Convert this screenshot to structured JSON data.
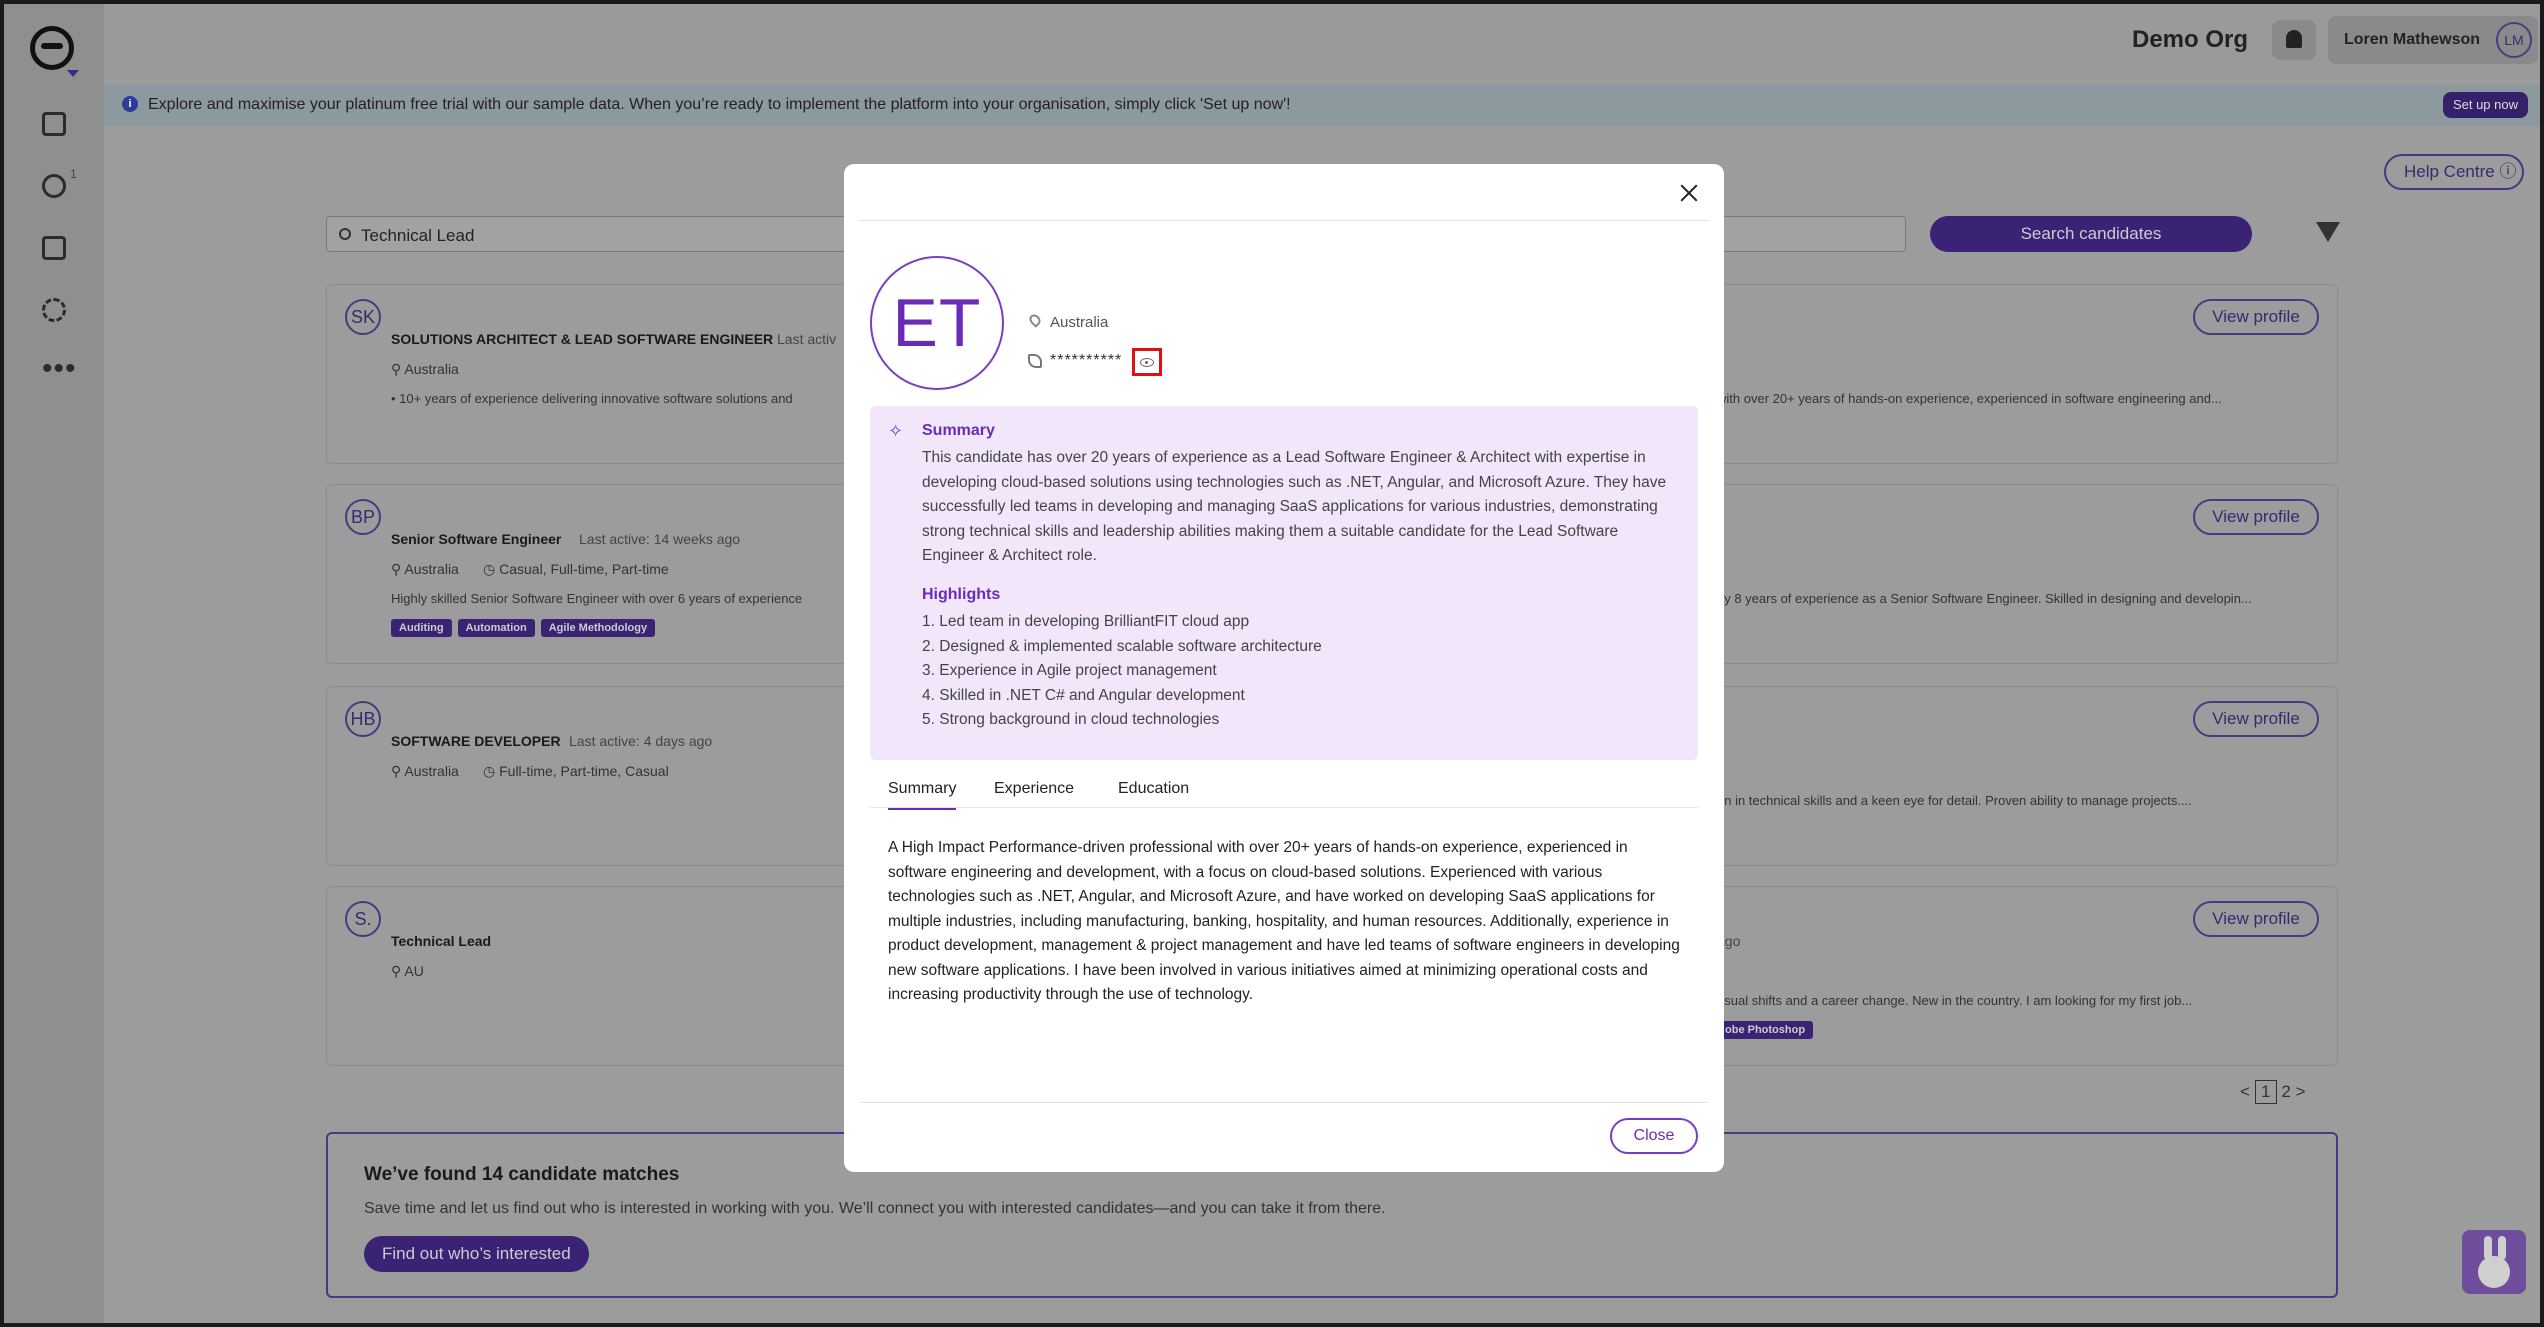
{
  "topbar": {
    "org_name": "Demo Org",
    "user_name": "Loren Mathewson",
    "user_initials": "LM"
  },
  "sidebar": {
    "badge": "1"
  },
  "banner": {
    "text": "Explore and maximise your platinum free trial with our sample data. When you’re ready to implement the platform into your organisation, simply click 'Set up now'!",
    "button": "Set up now"
  },
  "help_centre": "Help Centre",
  "search": {
    "value": "Technical Lead",
    "button": "Search candidates"
  },
  "cards": [
    {
      "initials": "SK",
      "title": "SOLUTIONS ARCHITECT & LEAD SOFTWARE ENGINEER",
      "active": "Last activ",
      "location": "Australia",
      "types": "",
      "desc_left": "• 10+ years of experience delivering innovative software solutions and",
      "desc_right": "with over 20+ years of hands-on experience, experienced in software engineering and...",
      "tags": [],
      "view": "View profile"
    },
    {
      "initials": "BP",
      "title": "Senior Software Engineer",
      "active": "Last active: 14 weeks ago",
      "location": "Australia",
      "types": "Casual, Full-time, Part-time",
      "desc_left": "Highly skilled Senior Software Engineer with over 6 years of experience",
      "desc_right": "rly 8 years of experience as a Senior Software Engineer. Skilled in designing and developin...",
      "tags": [
        "Auditing",
        "Automation",
        "Agile Methodology"
      ],
      "view": "View profile"
    },
    {
      "initials": "HB",
      "title": "SOFTWARE DEVELOPER",
      "active": "Last active: 4 days ago",
      "location": "Australia",
      "types": "Full-time, Part-time, Casual",
      "desc_left": "",
      "desc_right": "on in technical skills and a keen eye for detail. Proven ability to manage projects....",
      "tags": [],
      "view": "View profile"
    },
    {
      "initials": "S.",
      "title": "Technical Lead",
      "active": "ago",
      "location": "AU",
      "types": "",
      "desc_left": "",
      "desc_right": "asual shifts and a career change. New in the country. I am looking for my first job...",
      "tags": [
        "obe Photoshop"
      ],
      "view": "View profile"
    }
  ],
  "pagination": {
    "prev": "<",
    "current": "1",
    "next_page": "2",
    "next": ">"
  },
  "matches": {
    "title": "We’ve found 14 candidate matches",
    "subtitle": "Save time and let us find out who is interested in working with you. We’ll connect you with interested candidates—and you can take it from there.",
    "button": "Find out who’s interested"
  },
  "modal": {
    "initials": "ET",
    "location": "Australia",
    "phone_masked": "**********",
    "summary_heading": "Summary",
    "summary_text": "This candidate has over 20 years of experience as a Lead Software Engineer & Architect with expertise in developing cloud-based solutions using technologies such as .NET, Angular, and Microsoft Azure. They have successfully led teams in developing and managing SaaS applications for various industries, demonstrating strong technical skills and leadership abilities making them a suitable candidate for the Lead Software Engineer & Architect role.",
    "highlights_heading": "Highlights",
    "highlights": [
      "1. Led team in developing BrilliantFIT cloud app",
      "2. Designed & implemented scalable software architecture",
      "3. Experience in Agile project management",
      "4. Skilled in .NET C# and Angular development",
      "5. Strong background in cloud technologies"
    ],
    "tabs": [
      "Summary",
      "Experience",
      "Education"
    ],
    "profile_summary": "A High Impact Performance-driven professional with over 20+ years of hands-on experience, experienced in software engineering and development, with a focus on cloud-based solutions. Experienced with various technologies such as .NET, Angular, and Microsoft Azure, and have worked on developing SaaS applications for multiple industries, including manufacturing, banking, hospitality, and human resources. Additionally, experience in product development, management & project management and have led teams of software engineers in developing new software applications. I have been involved in various initiatives aimed at minimizing operational costs and increasing productivity through the use of technology.",
    "close_button": "Close"
  }
}
